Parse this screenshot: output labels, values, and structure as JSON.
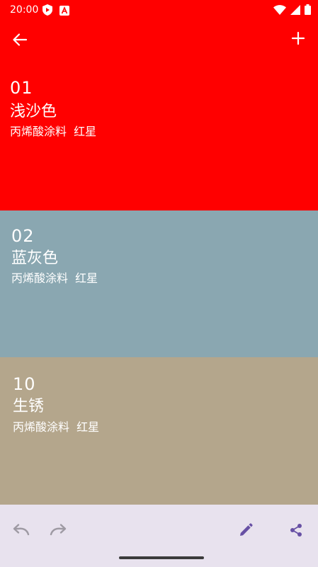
{
  "status_bar": {
    "time": "20:00",
    "icons_left": [
      "shield-play-icon",
      "text-a-icon"
    ],
    "icons_right": [
      "wifi-icon",
      "signal-icon",
      "battery-icon"
    ]
  },
  "app_bar": {
    "back_icon": "arrow-left-icon",
    "add_icon": "plus-icon"
  },
  "colors": [
    {
      "code": "01",
      "name": "浅沙色",
      "meta": "丙烯酸涂料  红星",
      "bg": "#ff0000"
    },
    {
      "code": "02",
      "name": "蓝灰色",
      "meta": "丙烯酸涂料  红星",
      "bg": "#8aa7b1"
    },
    {
      "code": "10",
      "name": "生锈",
      "meta": "丙烯酸涂料  红星",
      "bg": "#b4a68c"
    }
  ],
  "bottom_bar": {
    "undo_icon": "undo-icon",
    "redo_icon": "redo-icon",
    "edit_icon": "pencil-icon",
    "share_icon": "share-icon",
    "disabled_color": "#9e9aa3",
    "active_color": "#6750a4"
  }
}
